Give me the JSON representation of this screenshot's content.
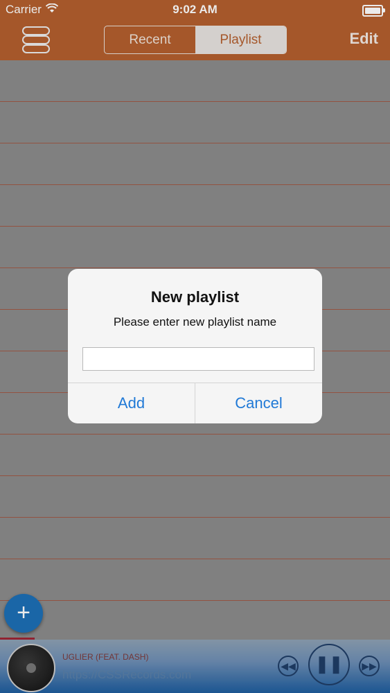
{
  "status": {
    "carrier": "Carrier",
    "time": "9:02 AM"
  },
  "navbar": {
    "tabs": [
      "Recent",
      "Playlist"
    ],
    "active_tab": "Playlist",
    "edit_label": "Edit"
  },
  "fab": {
    "label": "+"
  },
  "player": {
    "track": "UGLIER (FEAT. DASH)",
    "url": "https://CSSRecords.com"
  },
  "dialog": {
    "title": "New playlist",
    "message": "Please enter new playlist name",
    "input_value": "",
    "add_label": "Add",
    "cancel_label": "Cancel"
  },
  "colors": {
    "accent": "#b35f2e",
    "link": "#2079d6",
    "fab": "#1d6fb6"
  }
}
